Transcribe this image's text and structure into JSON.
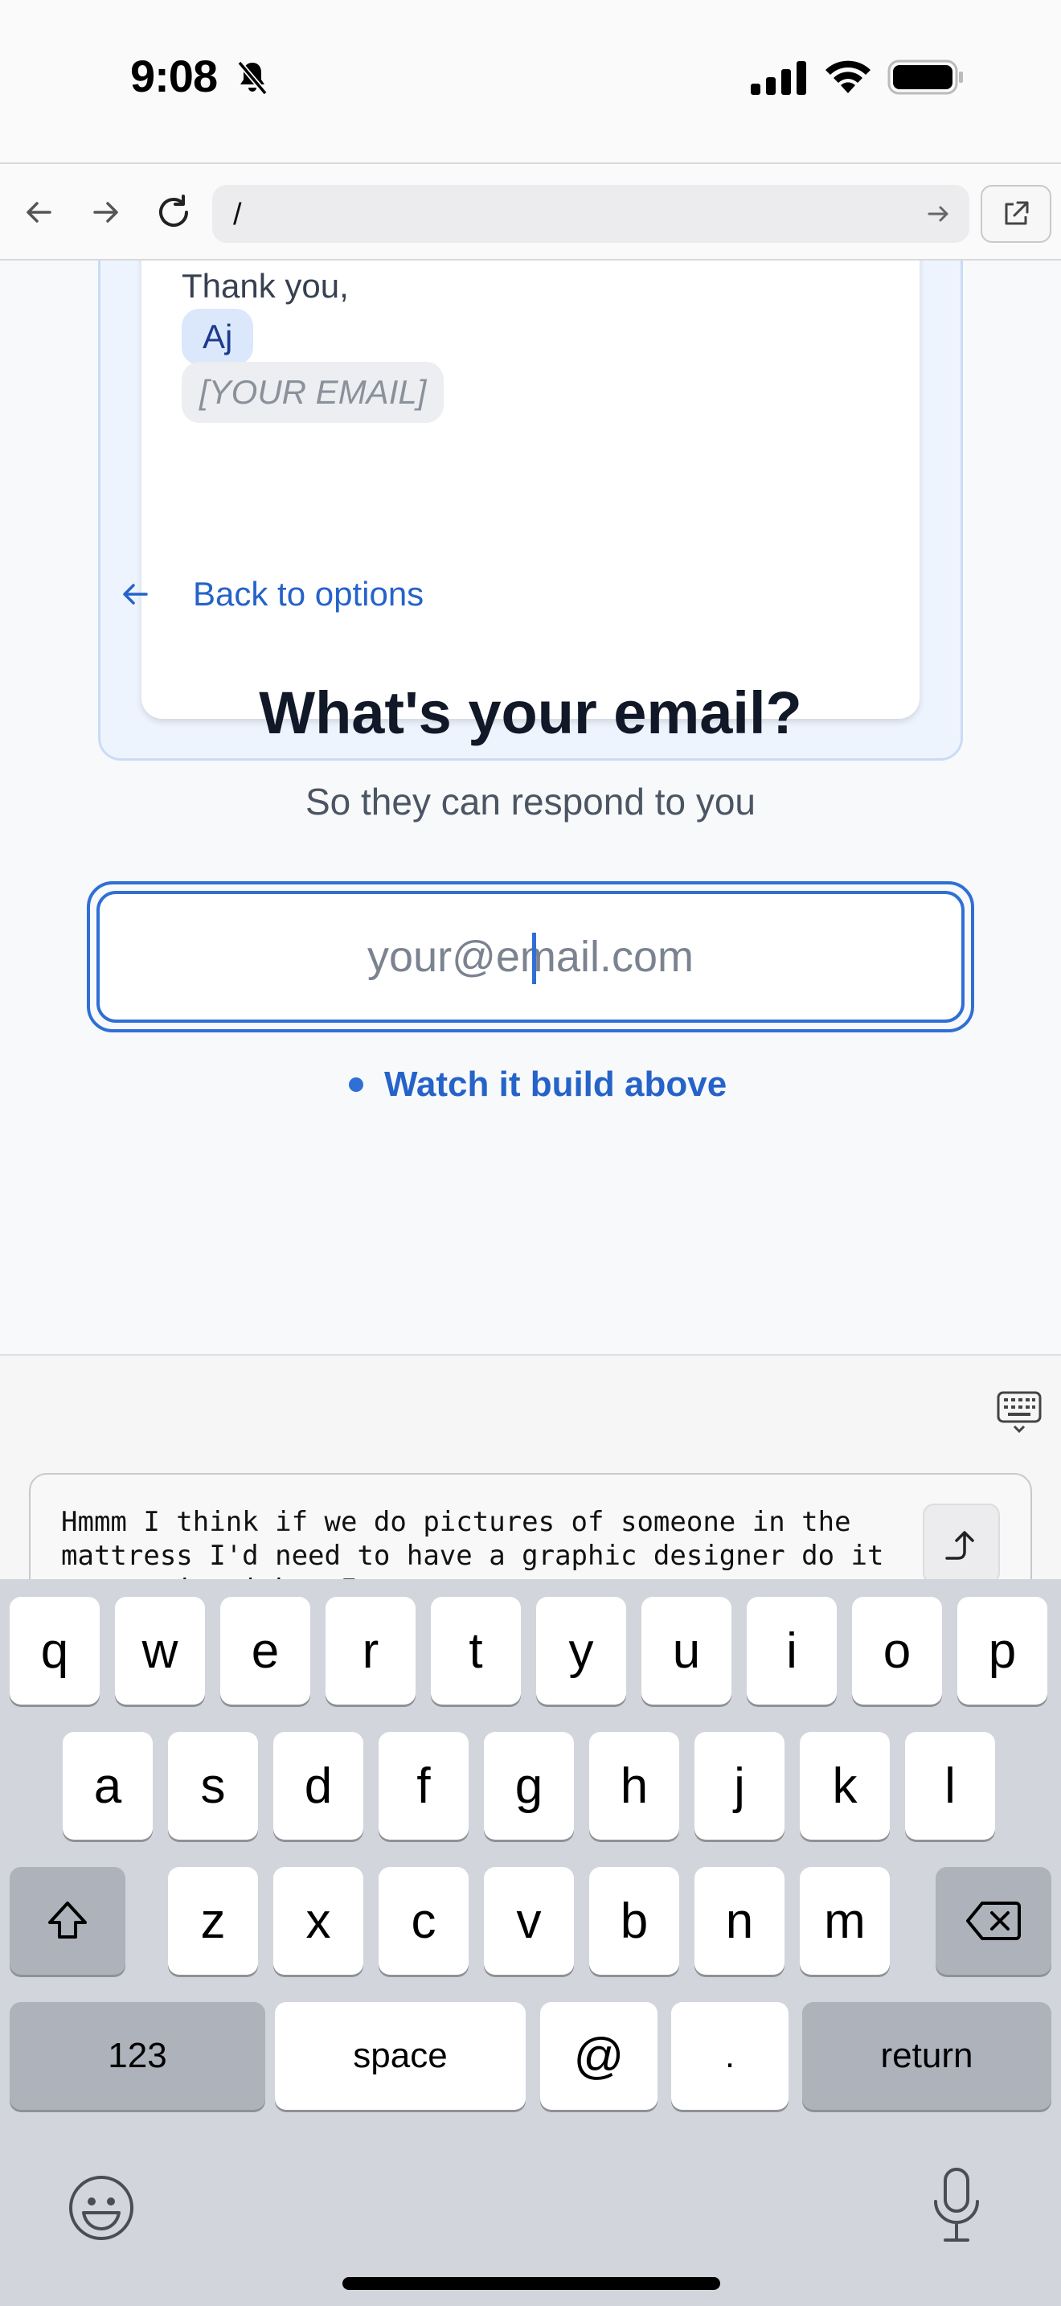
{
  "status_bar": {
    "time": "9:08"
  },
  "browser": {
    "url": "/"
  },
  "preview": {
    "closing": "Thank you,",
    "name": "Aj",
    "email_placeholder": "[YOUR EMAIL]"
  },
  "back_link": {
    "label": "Back to options"
  },
  "form": {
    "heading": "What's your email?",
    "subheading": "So they can respond to you",
    "email_placeholder": "your@email.com",
    "hint": "Watch it build above"
  },
  "composer": {
    "text": "Hmmm I think if we do pictures of someone in the mattress I'd need to have a graphic designer do it to get it right. I"
  },
  "keyboard": {
    "row1": [
      "q",
      "w",
      "e",
      "r",
      "t",
      "y",
      "u",
      "i",
      "o",
      "p"
    ],
    "row2": [
      "a",
      "s",
      "d",
      "f",
      "g",
      "h",
      "j",
      "k",
      "l"
    ],
    "row3": [
      "z",
      "x",
      "c",
      "v",
      "b",
      "n",
      "m"
    ],
    "numbers": "123",
    "space": "space",
    "at": "@",
    "dot": ".",
    "return": "return"
  }
}
